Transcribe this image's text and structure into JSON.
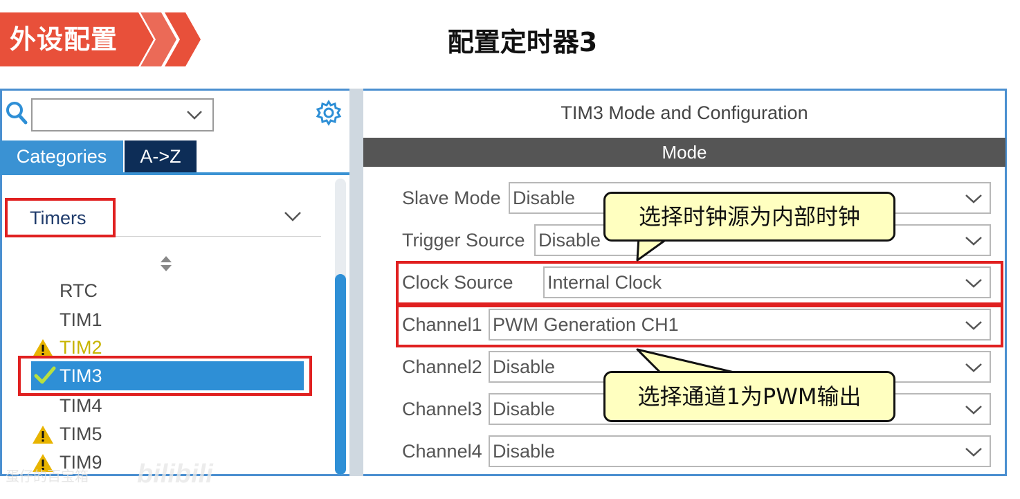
{
  "slide": {
    "section_label": "外设配置",
    "title": "配置定时器3"
  },
  "left_panel": {
    "search": {
      "value": ""
    },
    "tabs": [
      {
        "label": "Categories",
        "active": true
      },
      {
        "label": "A->Z",
        "active": false
      }
    ],
    "group": {
      "label": "Timers"
    },
    "items": [
      {
        "label": "RTC",
        "status": "none"
      },
      {
        "label": "TIM1",
        "status": "none"
      },
      {
        "label": "TIM2",
        "status": "warning"
      },
      {
        "label": "TIM3",
        "status": "ok",
        "selected": true
      },
      {
        "label": "TIM4",
        "status": "none"
      },
      {
        "label": "TIM5",
        "status": "warning"
      },
      {
        "label": "TIM9",
        "status": "warning"
      }
    ]
  },
  "right_panel": {
    "title": "TIM3 Mode and Configuration",
    "mode_header": "Mode",
    "fields": [
      {
        "label": "Slave Mode",
        "value": "Disable"
      },
      {
        "label": "Trigger Source",
        "value": "Disable"
      },
      {
        "label": "Clock Source",
        "value": "Internal Clock"
      },
      {
        "label": "Channel1",
        "value": "PWM Generation CH1"
      },
      {
        "label": "Channel2",
        "value": "Disable"
      },
      {
        "label": "Channel3",
        "value": "Disable"
      },
      {
        "label": "Channel4",
        "value": "Disable"
      }
    ]
  },
  "callouts": {
    "clock": "选择时钟源为内部时钟",
    "channel": "选择通道1为PWM输出"
  },
  "watermark": {
    "text": "蛋仔的百宝箱",
    "logo": "bilibili"
  },
  "colors": {
    "banner": "#e8503a",
    "accent_blue": "#3a92d3",
    "selected_row": "#2e8fd6",
    "highlight_red": "#e02020",
    "callout_fill": "#ffffc0",
    "mode_bar": "#555555",
    "warning": "#e8b400"
  },
  "icons": {
    "search": "magnifier-icon",
    "settings": "gear-icon",
    "dropdown": "chevron-down-icon",
    "sort": "sort-arrows-icon",
    "warning": "warning-triangle-icon",
    "ok": "checkmark-icon"
  }
}
